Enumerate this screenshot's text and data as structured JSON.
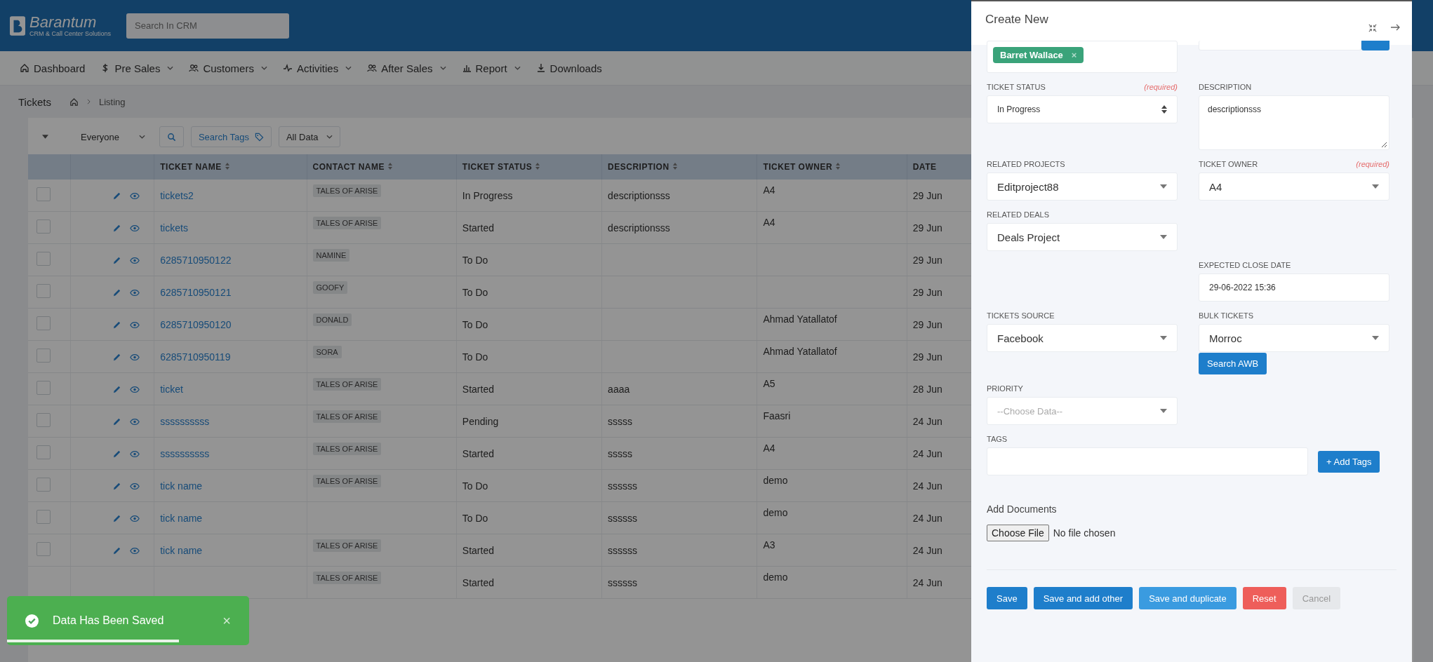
{
  "header": {
    "logo_name": "Barantum",
    "logo_tagline": "CRM & Call Center Solutions",
    "search": {
      "placeholder": "Search In CRM"
    }
  },
  "nav": [
    {
      "label": "Dashboard",
      "kind": "home",
      "dropdown": false
    },
    {
      "label": "Pre Sales",
      "kind": "dollar",
      "dropdown": true
    },
    {
      "label": "Customers",
      "kind": "users",
      "dropdown": true
    },
    {
      "label": "Activities",
      "kind": "pulse",
      "dropdown": true
    },
    {
      "label": "After Sales",
      "kind": "users",
      "dropdown": true
    },
    {
      "label": "Report",
      "kind": "chart",
      "dropdown": true
    },
    {
      "label": "Downloads",
      "kind": "download",
      "dropdown": false
    }
  ],
  "breadcrumb": {
    "title": "Tickets",
    "current": "Listing"
  },
  "toolbar": {
    "owner_filter": "Everyone",
    "search_tags": "Search Tags",
    "data_filter": "All Data"
  },
  "table": {
    "columns": [
      "TICKET NAME",
      "CONTACT NAME",
      "TICKET STATUS",
      "DESCRIPTION",
      "TICKET OWNER",
      "DATE"
    ],
    "rows": [
      {
        "checked": false,
        "ticket_name": "tickets2",
        "contact": "TALES OF ARISE",
        "status": "In Progress",
        "description": "descriptionsss",
        "owner": "A4",
        "date": "29 Jun"
      },
      {
        "checked": false,
        "ticket_name": "tickets",
        "contact": "TALES OF ARISE",
        "status": "Started",
        "description": "descriptionsss",
        "owner": "A4",
        "date": "29 Jun"
      },
      {
        "checked": false,
        "ticket_name": "6285710950122",
        "contact": "NAMINE",
        "status": "To Do",
        "date": "29 Jun"
      },
      {
        "checked": false,
        "ticket_name": "6285710950121",
        "contact": "GOOFY",
        "status": "To Do",
        "date": "29 Jun"
      },
      {
        "checked": false,
        "ticket_name": "6285710950120",
        "contact": "DONALD",
        "status": "To Do",
        "owner": "Ahmad Yatallatof",
        "date": "29 Jun"
      },
      {
        "checked": false,
        "ticket_name": "6285710950119",
        "contact": "SORA",
        "status": "To Do",
        "owner": "Ahmad Yatallatof",
        "date": "29 Jun"
      },
      {
        "checked": false,
        "ticket_name": "ticket",
        "contact": "TALES OF ARISE",
        "status": "Started",
        "description": "aaaa",
        "owner": "A5",
        "date": "28 Jun"
      },
      {
        "checked": false,
        "ticket_name": "ssssssssss",
        "contact": "TALES OF ARISE",
        "status": "Pending",
        "description": "sssss",
        "owner": "Faasri",
        "date": "24 Jun"
      },
      {
        "checked": false,
        "ticket_name": "ssssssssss",
        "contact": "TALES OF ARISE",
        "status": "Started",
        "description": "sssss",
        "owner": "A4",
        "date": "24 Jun"
      },
      {
        "checked": false,
        "ticket_name": "tick name",
        "contact": "TALES OF ARISE",
        "status": "To Do",
        "description": "ssssss",
        "owner": "demo",
        "date": "24 Jun"
      },
      {
        "checked": false,
        "ticket_name": "tick name",
        "status": "To Do",
        "description": "ssssss",
        "owner": "demo",
        "date": "24 Jun"
      },
      {
        "checked": false,
        "ticket_name": "tick name",
        "contact": "TALES OF ARISE",
        "status": "Started",
        "description": "ssssss",
        "owner": "A3",
        "date": "24 Jun"
      },
      {
        "contact": "TALES OF ARISE",
        "status": "Started",
        "description": "ssssss",
        "owner": "demo",
        "date": "24 Jun"
      }
    ]
  },
  "toast": {
    "message": "Data Has Been Saved",
    "close": "×",
    "level": 0.71
  },
  "panel": {
    "title": "Create New",
    "rows": [
      {
        "left": {
          "kind": "chips",
          "chips": [
            {
              "label": "Barret Wallace",
              "remove": "×"
            }
          ]
        },
        "right": {
          "kind": "stub"
        }
      },
      {
        "left": {
          "label": "TICKET STATUS",
          "required": "(required)",
          "kind": "native-select",
          "value": "In Progress"
        },
        "right": {
          "label": "DESCRIPTION",
          "kind": "textarea",
          "value": "descriptionsss"
        }
      },
      {
        "left": {
          "label": "RELATED PROJECTS",
          "kind": "select",
          "value": "Editproject88"
        },
        "right": {
          "label": "TICKET OWNER",
          "required": "(required)",
          "kind": "select",
          "value": "A4"
        }
      },
      {
        "left": {
          "label": "RELATED DEALS",
          "kind": "select",
          "value": "Deals Project"
        }
      },
      {
        "right": {
          "label": "EXPECTED CLOSE DATE",
          "kind": "input",
          "value": "29-06-2022 15:36"
        }
      },
      {
        "left": {
          "label": "TICKETS SOURCE",
          "kind": "select",
          "value": "Facebook"
        },
        "right": {
          "label": "BULK TICKETS",
          "kind": "select",
          "value": "Morroc",
          "button": "Search AWB"
        }
      },
      {
        "left": {
          "label": "PRIORITY",
          "kind": "select",
          "placeholder": "--Choose Data--"
        }
      }
    ],
    "tags": {
      "label": "TAGS",
      "button": "+ Add Tags"
    },
    "documents": {
      "label": "Add Documents",
      "button": "Choose File",
      "status": "No file chosen"
    },
    "actions": [
      {
        "label": "Save",
        "kind": "primary"
      },
      {
        "label": "Save and add other",
        "kind": "primary"
      },
      {
        "label": "Save and duplicate",
        "kind": "info"
      },
      {
        "label": "Reset",
        "kind": "danger"
      },
      {
        "label": "Cancel",
        "kind": "muted"
      }
    ]
  }
}
